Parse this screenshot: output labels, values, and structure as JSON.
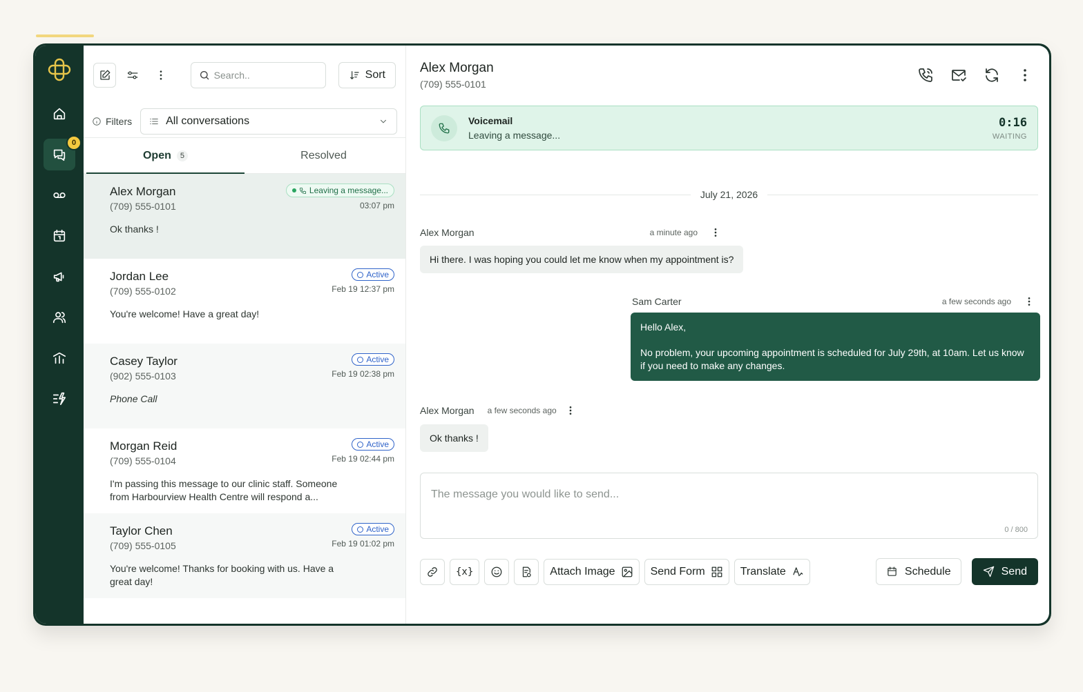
{
  "nav": {
    "badge_count": "0",
    "items": [
      "home",
      "conversations",
      "voicemail",
      "calendar",
      "campaigns",
      "contacts",
      "reports",
      "automations"
    ]
  },
  "list": {
    "search_placeholder": "Search..",
    "sort_label": "Sort",
    "filters_label": "Filters",
    "filter_value": "All conversations",
    "tabs": [
      {
        "label": "Open",
        "count": "5"
      },
      {
        "label": "Resolved"
      }
    ],
    "conversations": [
      {
        "name": "Alex Morgan",
        "phone": "(709) 555-0101",
        "status": "Leaving a message...",
        "time": "03:07 pm",
        "snippet": "Ok thanks !"
      },
      {
        "name": "Jordan Lee",
        "phone": "(709) 555-0102",
        "status": "Active",
        "time": "Feb 19 12:37 pm",
        "snippet": "You're welcome! Have a great day!"
      },
      {
        "name": "Casey Taylor",
        "phone": "(902) 555-0103",
        "status": "Active",
        "time": "Feb 19 02:38 pm",
        "snippet": "Phone Call"
      },
      {
        "name": "Morgan Reid",
        "phone": "(709) 555-0104",
        "status": "Active",
        "time": "Feb 19 02:44 pm",
        "snippet": "I'm passing this message to our clinic staff. Someone from Harbourview Health Centre will respond a..."
      },
      {
        "name": "Taylor Chen",
        "phone": "(709) 555-0105",
        "status": "Active",
        "time": "Feb 19 01:02 pm",
        "snippet": "You're welcome! Thanks for booking with us. Have a great day!"
      }
    ]
  },
  "chat": {
    "contact_name": "Alex Morgan",
    "contact_phone": "(709) 555-0101",
    "voicemail": {
      "title": "Voicemail",
      "subtitle": "Leaving a message...",
      "timer": "0:16",
      "state": "WAITING"
    },
    "date_separator": "July 21, 2026",
    "messages": [
      {
        "sender": "Alex Morgan",
        "ago": "a minute ago",
        "text": "Hi there. I was hoping you could let me know when my appointment is?"
      },
      {
        "sender": "Sam Carter",
        "ago": "a few seconds ago",
        "line1": "Hello Alex,",
        "line2": "No problem, your upcoming appointment is scheduled for July 29th, at 10am. Let us know if you need to make any changes."
      },
      {
        "sender": "Alex Morgan",
        "ago": "a few seconds ago",
        "text": "Ok thanks !"
      }
    ],
    "composer": {
      "placeholder": "The message you would like to send...",
      "counter": "0 / 800"
    },
    "tools": {
      "variable_label": "{x}",
      "attach_image": "Attach Image",
      "send_form": "Send Form",
      "translate": "Translate",
      "schedule": "Schedule",
      "send": "Send"
    }
  },
  "colors": {
    "sidebar": "#14342a",
    "accent": "#215a46",
    "badge": "#f5c93f",
    "active_pill": "#2f63c9",
    "voicemail_bg": "#dff4e9"
  }
}
